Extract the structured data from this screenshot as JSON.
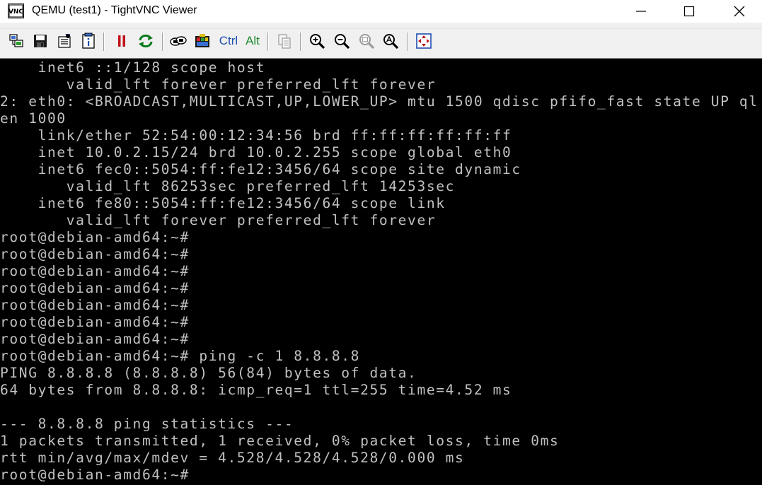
{
  "window": {
    "title": "QEMU (test1) - TightVNC Viewer",
    "app_icon": "tightvnc-logo-icon",
    "app_icon_text": "VNC"
  },
  "toolbar": {
    "items": [
      {
        "name": "new-connection-icon",
        "tooltip": ""
      },
      {
        "name": "save-icon",
        "tooltip": ""
      },
      {
        "name": "options-icon",
        "tooltip": ""
      },
      {
        "name": "connection-info-icon",
        "tooltip": ""
      },
      {
        "name": "pause-icon",
        "tooltip": ""
      },
      {
        "name": "refresh-icon",
        "tooltip": ""
      },
      {
        "name": "transfer-icon",
        "tooltip": ""
      },
      {
        "name": "ctrl-alt-del-icon",
        "tooltip": ""
      },
      {
        "name": "copy-icon",
        "tooltip": ""
      },
      {
        "name": "zoom-in-icon",
        "tooltip": ""
      },
      {
        "name": "zoom-out-icon",
        "tooltip": ""
      },
      {
        "name": "zoom-100-icon",
        "tooltip": ""
      },
      {
        "name": "zoom-auto-icon",
        "tooltip": ""
      },
      {
        "name": "fullscreen-icon",
        "tooltip": ""
      }
    ],
    "ctrl_label": "Ctrl",
    "alt_label": "Alt"
  },
  "terminal": {
    "lines": [
      "    inet6 ::1/128 scope host",
      "       valid_lft forever preferred_lft forever",
      "2: eth0: <BROADCAST,MULTICAST,UP,LOWER_UP> mtu 1500 qdisc pfifo_fast state UP ql",
      "en 1000",
      "    link/ether 52:54:00:12:34:56 brd ff:ff:ff:ff:ff:ff",
      "    inet 10.0.2.15/24 brd 10.0.2.255 scope global eth0",
      "    inet6 fec0::5054:ff:fe12:3456/64 scope site dynamic",
      "       valid_lft 86253sec preferred_lft 14253sec",
      "    inet6 fe80::5054:ff:fe12:3456/64 scope link",
      "       valid_lft forever preferred_lft forever",
      "root@debian-amd64:~#",
      "root@debian-amd64:~#",
      "root@debian-amd64:~#",
      "root@debian-amd64:~#",
      "root@debian-amd64:~#",
      "root@debian-amd64:~#",
      "root@debian-amd64:~#",
      "root@debian-amd64:~# ping -c 1 8.8.8.8",
      "PING 8.8.8.8 (8.8.8.8) 56(84) bytes of data.",
      "64 bytes from 8.8.8.8: icmp_req=1 ttl=255 time=4.52 ms",
      "",
      "--- 8.8.8.8 ping statistics ---",
      "1 packets transmitted, 1 received, 0% packet loss, time 0ms",
      "rtt min/avg/max/mdev = 4.528/4.528/4.528/0.000 ms",
      "root@debian-amd64:~#"
    ]
  },
  "colors": {
    "terminal_bg": "#000000",
    "terminal_fg": "#c0c0c0",
    "titlebar_bg": "#ffffff",
    "toolbar_bg": "#f0f0f0"
  }
}
